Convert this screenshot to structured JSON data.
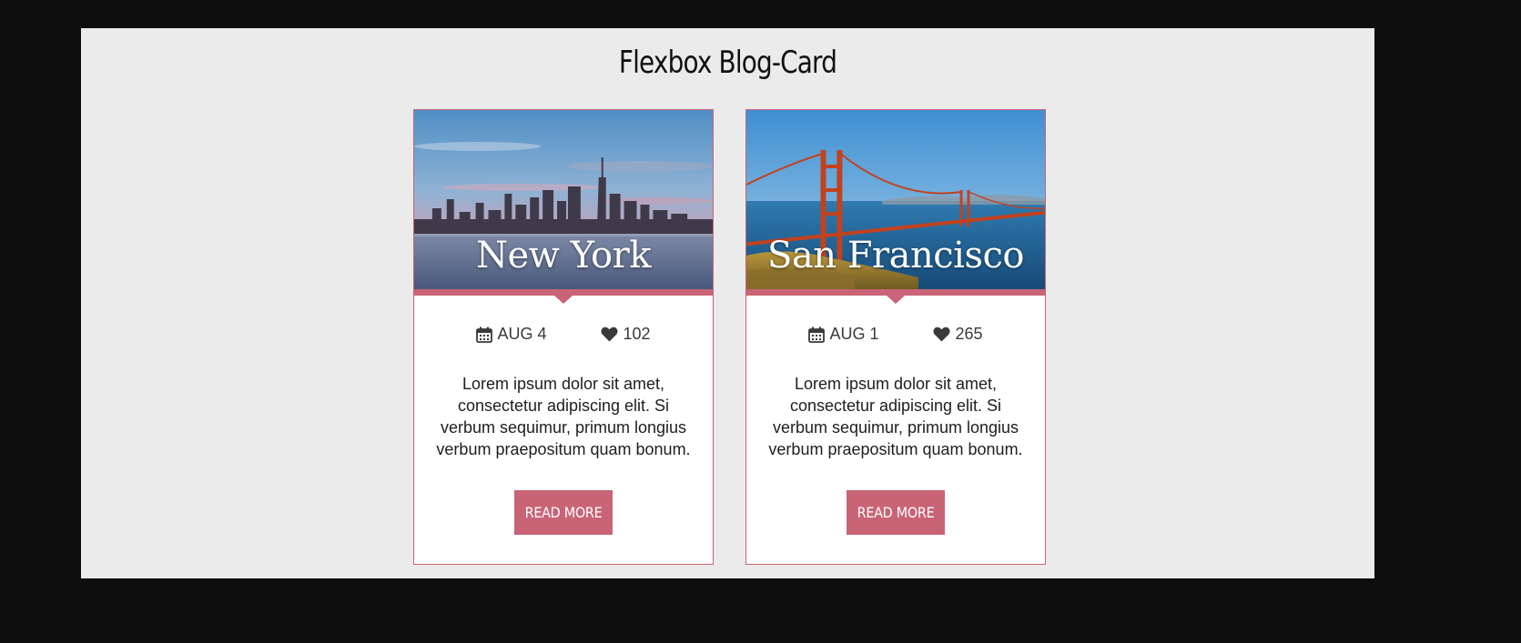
{
  "page": {
    "title": "Flexbox Blog-Card"
  },
  "cards": [
    {
      "city": "New York",
      "date": "AUG 4",
      "likes": "102",
      "text": "Lorem ipsum dolor sit amet, consectetur adipiscing elit. Si verbum sequimur, primum longius verbum praepositum quam bonum.",
      "button_label": "READ MORE",
      "image": "new-york-skyline-photo"
    },
    {
      "city": "San Francisco",
      "date": "AUG 1",
      "likes": "265",
      "text": "Lorem ipsum dolor sit amet, consectetur adipiscing elit. Si verbum sequimur, primum longius verbum praepositum quam bonum.",
      "button_label": "READ MORE",
      "image": "golden-gate-bridge-photo"
    }
  ],
  "icons": {
    "date": "calendar-icon",
    "likes": "heart-icon"
  },
  "colors": {
    "accent": "#c96476",
    "panel_bg": "#ebebeb",
    "page_bg": "#0e0e0e",
    "card_bg": "#ffffff"
  }
}
